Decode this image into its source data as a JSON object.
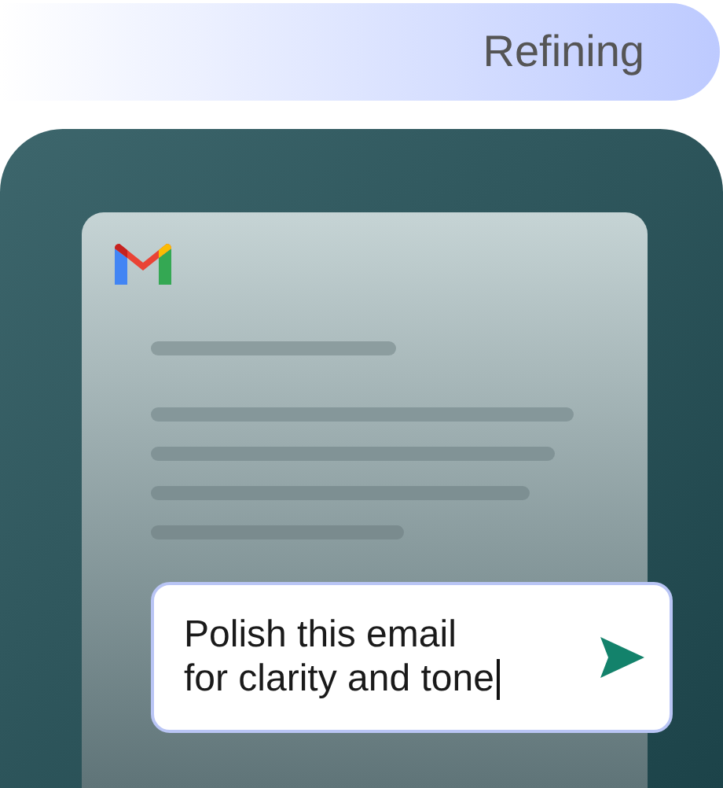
{
  "status": {
    "label": "Refining"
  },
  "prompt": {
    "lines": [
      "Polish this email",
      "for clarity and tone"
    ],
    "focused": true
  }
}
